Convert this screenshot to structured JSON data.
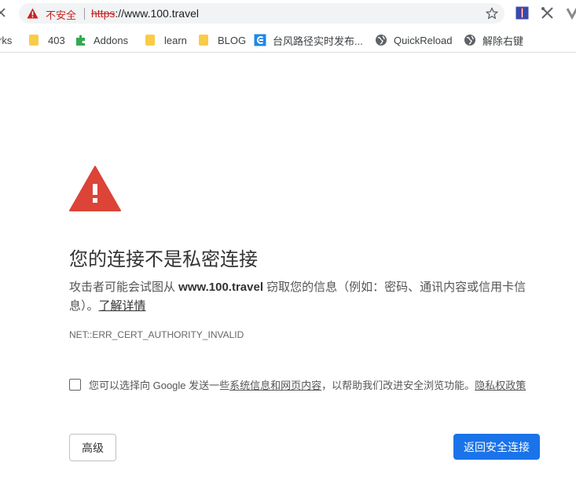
{
  "omnibox": {
    "security_label": "不安全",
    "url_scheme": "https",
    "url_rest": "://www.100.travel"
  },
  "bookmarks": [
    {
      "label": "rks",
      "icon": "bookmarks-folder-partial"
    },
    {
      "label": "403",
      "icon": "folder-icon"
    },
    {
      "label": "Addons",
      "icon": "puzzle-icon"
    },
    {
      "label": "learn",
      "icon": "folder-icon"
    },
    {
      "label": "BLOG",
      "icon": "folder-icon"
    },
    {
      "label": "台风路径实时发布...",
      "icon": "typhoon-site-icon"
    },
    {
      "label": "QuickReload",
      "icon": "globe-icon"
    },
    {
      "label": "解除右键",
      "icon": "globe-icon"
    }
  ],
  "interstitial": {
    "title": "您的连接不是私密连接",
    "desc_prefix": "攻击者可能会试图从 ",
    "desc_host": "www.100.travel",
    "desc_suffix": " 窃取您的信息（例如：密码、通讯内容或信用卡信息）。",
    "learn_more": "了解详情",
    "error_code": "NET::ERR_CERT_AUTHORITY_INVALID",
    "optin_prefix": "您可以选择向 Google 发送一些",
    "optin_link": "系统信息和网页内容",
    "optin_suffix": "，以帮助我们改进安全浏览功能。",
    "privacy_link": "隐私权政策",
    "advanced_button": "高级",
    "back_button": "返回安全连接"
  },
  "colors": {
    "danger_red": "#db4437",
    "insecure_red": "#c5221f",
    "primary_blue": "#1a73e8"
  }
}
